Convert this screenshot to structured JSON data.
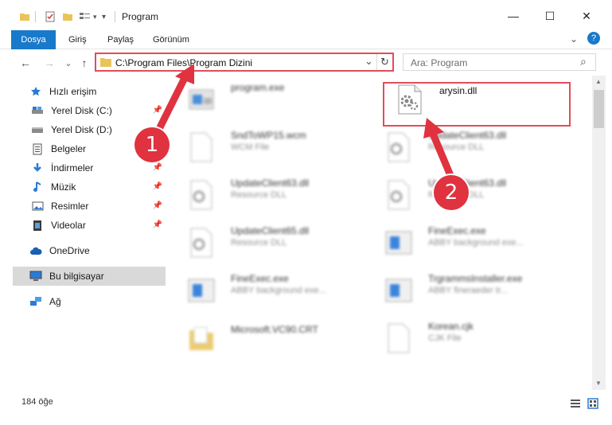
{
  "window": {
    "title": "Program",
    "minimize": "—",
    "maximize": "☐",
    "close": "✕"
  },
  "ribbon": {
    "tabs": [
      "Dosya",
      "Giriş",
      "Paylaş",
      "Görünüm"
    ],
    "expand_chevron": "⌄",
    "help": "?"
  },
  "nav": {
    "back": "←",
    "forward": "→",
    "recent": "⌄",
    "up": "↑",
    "address": "C:\\Program Files\\Program Dizini",
    "address_dropdown": "⌄",
    "refresh": "↻",
    "search_placeholder": "Ara: Program",
    "search_icon": "⌕"
  },
  "sidebar": {
    "items": [
      {
        "label": "Hızlı erişim",
        "icon": "star-icon",
        "pinned": false
      },
      {
        "label": "Yerel Disk (C:)",
        "icon": "drive-icon",
        "pinned": true
      },
      {
        "label": "Yerel Disk (D:)",
        "icon": "drive-icon",
        "pinned": false
      },
      {
        "label": "Belgeler",
        "icon": "documents-icon",
        "pinned": true
      },
      {
        "label": "İndirmeler",
        "icon": "download-icon",
        "pinned": true
      },
      {
        "label": "Müzik",
        "icon": "music-icon",
        "pinned": true
      },
      {
        "label": "Resimler",
        "icon": "pictures-icon",
        "pinned": true
      },
      {
        "label": "Videolar",
        "icon": "videos-icon",
        "pinned": true
      },
      {
        "label": "OneDrive",
        "icon": "cloud-icon",
        "pinned": false
      },
      {
        "label": "Bu bilgisayar",
        "icon": "computer-icon",
        "pinned": false,
        "selected": true
      },
      {
        "label": "Ağ",
        "icon": "network-icon",
        "pinned": false
      }
    ]
  },
  "files": [
    {
      "name": "program.exe",
      "sub": "",
      "icon": "exe-icon",
      "highlighted": false
    },
    {
      "name": "arysin.dll",
      "sub": "",
      "icon": "dll-gear-icon",
      "highlighted": true
    },
    {
      "name": "SndToWP15.wcm",
      "sub": "WCM File",
      "icon": "generic-file-icon",
      "highlighted": false
    },
    {
      "name": "UpdateClient63.dll",
      "sub": "Resource DLL",
      "icon": "dll-gear-icon",
      "highlighted": false
    },
    {
      "name": "UpdateClient63.dll",
      "sub": "Resource DLL",
      "icon": "dll-gear-icon",
      "highlighted": false
    },
    {
      "name": "UpdateClient63.dll",
      "sub": "Resource DLL",
      "icon": "dll-gear-icon",
      "highlighted": false
    },
    {
      "name": "UpdateClient65.dll",
      "sub": "Resource DLL",
      "icon": "dll-gear-icon",
      "highlighted": false
    },
    {
      "name": "FineExec.exe",
      "sub": "ABBY background exe...",
      "icon": "exe-icon",
      "highlighted": false
    },
    {
      "name": "FineExec.exe",
      "sub": "ABBY background exe...",
      "icon": "exe-icon",
      "highlighted": false
    },
    {
      "name": "TrgrammsInstaller.exe",
      "sub": "ABBY fineraeder tr...",
      "icon": "exe-icon",
      "highlighted": false
    },
    {
      "name": "Microsoft.VC90.CRT",
      "sub": "",
      "icon": "folder-icon",
      "highlighted": false
    },
    {
      "name": "Korean.cjk",
      "sub": "CJK File",
      "icon": "generic-file-icon",
      "highlighted": false
    }
  ],
  "status": {
    "count": "184 öğe"
  },
  "annotations": {
    "marker1": "1",
    "marker2": "2",
    "color": "#e0323f"
  },
  "colors": {
    "accent": "#1979ca",
    "highlight": "#e14d5a",
    "folder": "#e9c45a"
  }
}
